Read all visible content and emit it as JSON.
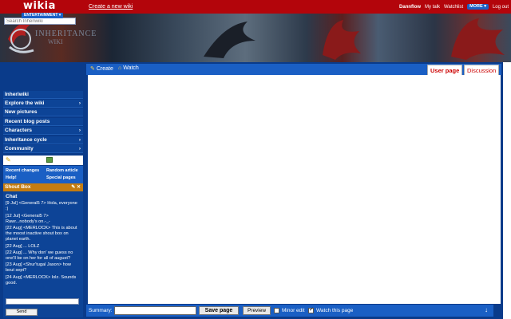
{
  "topbar": {
    "logo": "wikia",
    "hub": "ENTERTAINMENT",
    "create_wiki": "Create a new wiki",
    "username": "Dannflow",
    "my_talk": "My talk",
    "watchlist": "Watchlist",
    "more": "MORE",
    "logout": "Log out"
  },
  "banner": {
    "title": "INHERITANCE",
    "subtitle": "WIKI"
  },
  "sidebar": {
    "search_placeholder": "Search Inheriwiki",
    "items": [
      {
        "label": "Inheriwiki",
        "chevron": ""
      },
      {
        "label": "Explore the wiki",
        "chevron": "›"
      },
      {
        "label": "New pictures",
        "chevron": ""
      },
      {
        "label": "Recent blog posts",
        "chevron": ""
      },
      {
        "label": "Characters",
        "chevron": "›"
      },
      {
        "label": "Inheritance cycle",
        "chevron": "›"
      },
      {
        "label": "Community",
        "chevron": "›"
      }
    ],
    "quick_links": {
      "recent_changes": "Recent changes",
      "random_article": "Random article",
      "help": "Help!",
      "special_pages": "Special pages"
    },
    "shoutbox": {
      "title": "Shout Box",
      "chat_label": "Chat",
      "messages": [
        "[9 Jul] <General5 7> Hola, everyone :)",
        "[12 Jul] <General5 7> Rawr...nobody's on.-_-",
        "[22 Aug] <MERLOCK> This is about the moost inactive shout box on planet earth.",
        "[22 Aug] ... LOLZ",
        "[22 Aug] ... Why don' we guess no one'll be on her for all of august?",
        "[23 Aug] <Shur'tugal Jason> how bout sept?",
        "[24 Aug] <MERLOCK> lolz. Sounds good."
      ],
      "send_label": "Send"
    }
  },
  "main": {
    "actions": {
      "create": "Create",
      "watch": "Watch"
    },
    "tabs": {
      "user_page": "User page",
      "discussion": "Discussion"
    },
    "editbar": {
      "summary_label": "Summary:",
      "save_label": "Save page",
      "preview_label": "Preview",
      "minor_edit": "Minor edit",
      "watch_page": "Watch this page",
      "minor_checked": false,
      "watch_checked": true,
      "down_arrow": "↓"
    }
  },
  "colors": {
    "topbar": "#b3050b",
    "sidebar": "#0a3b8a",
    "accent": "#1a5fc4",
    "shout_header": "#c47c10"
  }
}
